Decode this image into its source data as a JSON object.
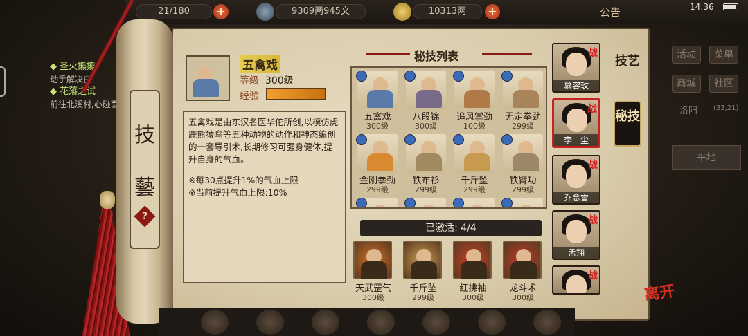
{
  "topbar": {
    "followers": "21/180",
    "silver": "9309两945文",
    "gold": "10313两",
    "notice": "公告",
    "time": "14:36"
  },
  "quests": [
    {
      "title": "圣火熊熊",
      "desc": "动手解决白"
    },
    {
      "title": "花落之试",
      "desc": "前往北溪村,心碰面"
    }
  ],
  "scroll": {
    "title_top": "技",
    "title_bottom": "藝",
    "help": "?"
  },
  "skill": {
    "name": "五禽戏",
    "level_label": "等级",
    "level_value": "300级",
    "exp_label": "经验",
    "exp_fraction": 1.0,
    "description": "五禽戏是由东汉名医华佗所创,以模仿虎鹿熊猿鸟等五种动物的动作和神态编创的一套导引术,长期修习可强身健体,提升自身的气血。",
    "note1": "※每30点提升1%的气血上限",
    "note2": "※当前提升气血上限:10%"
  },
  "list": {
    "title": "秘技列表",
    "items": [
      {
        "name": "五禽戏",
        "level": "300级",
        "color": "#5a7aa8"
      },
      {
        "name": "八段锦",
        "level": "300级",
        "color": "#7a6a8a"
      },
      {
        "name": "追风掌劲",
        "level": "100级",
        "color": "#b07a48"
      },
      {
        "name": "无定拳劲",
        "level": "299级",
        "color": "#a8845a"
      },
      {
        "name": "金刚拳劲",
        "level": "299级",
        "color": "#d88a30"
      },
      {
        "name": "铁布衫",
        "level": "299级",
        "color": "#a08a60"
      },
      {
        "name": "千斤坠",
        "level": "299级",
        "color": "#c89a50"
      },
      {
        "name": "铁臂功",
        "level": "299级",
        "color": "#9a8868"
      },
      {
        "name": "",
        "level": "",
        "color": "#b04a3a"
      },
      {
        "name": "",
        "level": "",
        "color": "#4a7a4a"
      },
      {
        "name": "",
        "level": "",
        "color": "#8a4a9a"
      },
      {
        "name": "",
        "level": "",
        "color": "#4a6ab0"
      }
    ]
  },
  "activated": {
    "label": "已激活: 4/4",
    "items": [
      {
        "name": "天武罡气",
        "level": "300级",
        "color": "#d07028"
      },
      {
        "name": "千斤坠",
        "level": "299级",
        "color": "#c89a50"
      },
      {
        "name": "红拂袖",
        "level": "300级",
        "color": "#c8402a"
      },
      {
        "name": "龙斗术",
        "level": "300级",
        "color": "#b83a2a"
      }
    ]
  },
  "characters": [
    {
      "name": "慕容玫",
      "selected": false
    },
    {
      "name": "李一尘",
      "selected": true
    },
    {
      "name": "乔念雪",
      "selected": false
    },
    {
      "name": "孟翔",
      "selected": false
    },
    {
      "name": "",
      "selected": false
    }
  ],
  "char_badge": "战",
  "tabs": {
    "tab1": "技艺",
    "tab2": "秘技"
  },
  "side": {
    "buttons": [
      "活动",
      "菜单",
      "商城",
      "社区"
    ],
    "location": "洛阳",
    "coord": "(33,21)",
    "terrain": "平地",
    "leave": "离开"
  }
}
